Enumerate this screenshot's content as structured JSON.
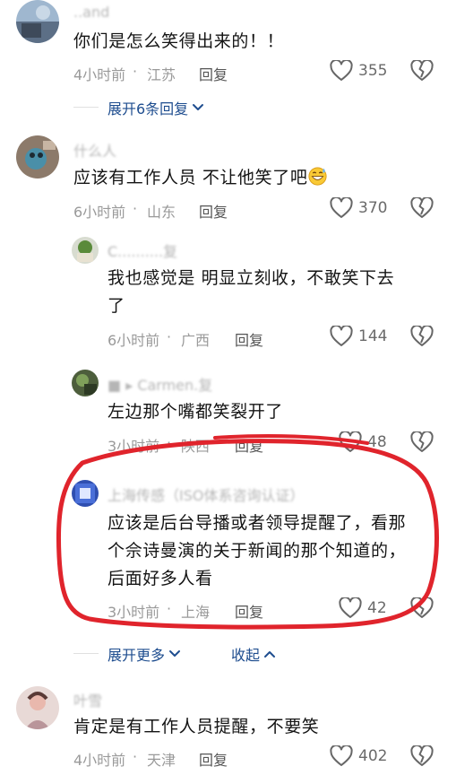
{
  "comments": [
    {
      "username": "..and",
      "text": "你们是怎么笑得出来的！！",
      "time": "4小时前",
      "location": "江苏",
      "reply_label": "回复",
      "likes": "355",
      "expand_label": "展开6条回复"
    },
    {
      "username": "什么人",
      "text": "应该有工作人员 不让他笑了吧",
      "emoji": "grinning-sweat",
      "time": "6小时前",
      "location": "山东",
      "reply_label": "回复",
      "likes": "370"
    },
    {
      "username": "C..........复",
      "text_line1": "我也感觉是 明显立刻收，不敢笑下去",
      "text_line2": "了",
      "time": "6小时前",
      "location": "广西",
      "reply_label": "回复",
      "likes": "144"
    },
    {
      "username": "■ ▸ Carmen.复",
      "text": "左边那个嘴都笑裂开了",
      "time": "3小时前",
      "location": "陕西",
      "reply_label": "回复",
      "likes": "48"
    },
    {
      "username": "上海传感（ISO体系咨询认证）",
      "text_line1": "应该是后台导播或者领导提醒了，看那",
      "text_line2": "个佘诗曼演的关于新闻的那个知道的，",
      "text_line3": "后面好多人看",
      "time": "3小时前",
      "location": "上海",
      "reply_label": "回复",
      "likes": "42"
    },
    {
      "username": "叶雪",
      "text": "肯定是有工作人员提醒，不要笑",
      "time": "4小时前",
      "location": "天津",
      "reply_label": "回复",
      "likes": "402"
    }
  ],
  "thread_controls": {
    "expand_more_label": "展开更多",
    "collapse_label": "收起"
  },
  "colors": {
    "link_blue": "#1e4d8f",
    "annotation_red": "#e0242c",
    "meta_gray": "#9a9a9a"
  },
  "icons": [
    "like-heart-icon",
    "dislike-broken-heart-icon",
    "chevron-down-icon",
    "chevron-up-icon"
  ]
}
